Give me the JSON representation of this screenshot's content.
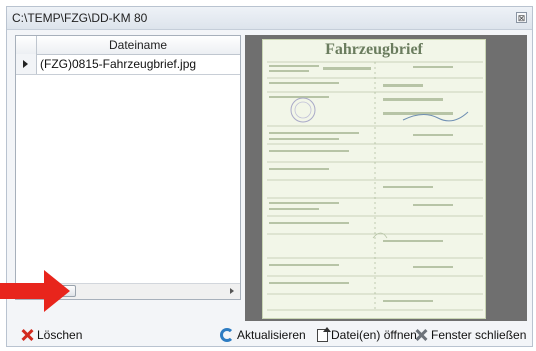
{
  "window": {
    "title": "C:\\TEMP\\FZG\\DD-KM 80",
    "close_glyph": "⊠"
  },
  "grid": {
    "column_header": "Dateiname",
    "rows": [
      {
        "filename": "(FZG)0815-Fahrzeugbrief.jpg"
      }
    ],
    "scroll_thumb_grip": "III"
  },
  "preview": {
    "document_title": "Fahrzeugbrief"
  },
  "toolbar": {
    "delete_label": "Löschen",
    "refresh_label": "Aktualisieren",
    "open_label": "Datei(en) öffnen",
    "close_label": "Fenster schließen"
  },
  "colors": {
    "arrow": "#e8251c",
    "preview_bg": "#6f6f6f",
    "document_paper": "#f2f6e8"
  },
  "icons": [
    "close-icon",
    "row-selector-icon",
    "scroll-left-icon",
    "scroll-right-icon",
    "delete-icon",
    "refresh-icon",
    "open-file-icon",
    "close-window-icon",
    "arrow-icon"
  ]
}
